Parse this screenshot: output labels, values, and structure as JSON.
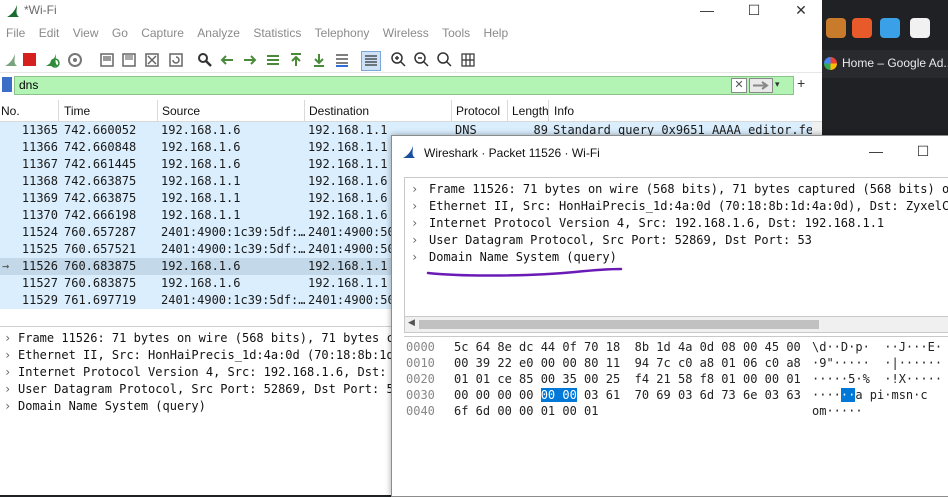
{
  "main_window": {
    "title": "*Wi-Fi",
    "controls": {
      "minimize": "—",
      "maximize": "☐",
      "close": "✕"
    },
    "menu": [
      "File",
      "Edit",
      "View",
      "Go",
      "Capture",
      "Analyze",
      "Statistics",
      "Telephony",
      "Wireless",
      "Tools",
      "Help"
    ],
    "filter": {
      "value": "dns",
      "clear": "✕",
      "dropdown": "▾",
      "add": "+"
    },
    "columns": [
      "No.",
      "Time",
      "Source",
      "Destination",
      "Protocol",
      "Length",
      "Info"
    ],
    "packets": [
      {
        "no": "11365",
        "time": "742.660052",
        "src": "192.168.1.6",
        "dst": "192.168.1.1",
        "proto": "DNS",
        "len": "89",
        "info": "Standard query 0x9651 AAAA editor.fe"
      },
      {
        "no": "11366",
        "time": "742.660848",
        "src": "192.168.1.6",
        "dst": "192.168.1.1",
        "proto": "",
        "len": "",
        "info": ""
      },
      {
        "no": "11367",
        "time": "742.661445",
        "src": "192.168.1.6",
        "dst": "192.168.1.1",
        "proto": "",
        "len": "",
        "info": ""
      },
      {
        "no": "11368",
        "time": "742.663875",
        "src": "192.168.1.1",
        "dst": "192.168.1.6",
        "proto": "",
        "len": "",
        "info": ""
      },
      {
        "no": "11369",
        "time": "742.663875",
        "src": "192.168.1.1",
        "dst": "192.168.1.6",
        "proto": "",
        "len": "",
        "info": ""
      },
      {
        "no": "11370",
        "time": "742.666198",
        "src": "192.168.1.1",
        "dst": "192.168.1.6",
        "proto": "",
        "len": "",
        "info": ""
      },
      {
        "no": "11524",
        "time": "760.657287",
        "src": "2401:4900:1c39:5df:…",
        "dst": "2401:4900:50",
        "proto": "",
        "len": "",
        "info": ""
      },
      {
        "no": "11525",
        "time": "760.657521",
        "src": "2401:4900:1c39:5df:…",
        "dst": "2401:4900:50",
        "proto": "",
        "len": "",
        "info": ""
      },
      {
        "no": "11526",
        "time": "760.683875",
        "src": "192.168.1.6",
        "dst": "192.168.1.1",
        "proto": "",
        "len": "",
        "info": "",
        "selected": true
      },
      {
        "no": "11527",
        "time": "760.683875",
        "src": "192.168.1.6",
        "dst": "192.168.1.1",
        "proto": "",
        "len": "",
        "info": ""
      },
      {
        "no": "11529",
        "time": "761.697719",
        "src": "2401:4900:1c39:5df:…",
        "dst": "2401:4900:50",
        "proto": "",
        "len": "",
        "info": ""
      }
    ],
    "details": [
      "Frame 11526: 71 bytes on wire (568 bits), 71 bytes ca",
      "Ethernet II, Src: HonHaiPrecis_1d:4a:0d (70:18:8b:1d:",
      "Internet Protocol Version 4, Src: 192.168.1.6, Dst: 1",
      "User Datagram Protocol, Src Port: 52869, Dst Port: 53",
      "Domain Name System (query)"
    ],
    "tree_arrow": "›"
  },
  "browser_strip": {
    "tab_title": "Home – Google Ad..."
  },
  "packet_window": {
    "title": "Wireshark · Packet 11526 · Wi-Fi",
    "controls": {
      "minimize": "—",
      "maximize": "☐"
    },
    "tree": [
      "Frame 11526: 71 bytes on wire (568 bits), 71 bytes captured (568 bits) on i",
      "Ethernet II, Src: HonHaiPrecis_1d:4a:0d (70:18:8b:1d:4a:0d), Dst: ZyxelComm",
      "Internet Protocol Version 4, Src: 192.168.1.6, Dst: 192.168.1.1",
      "User Datagram Protocol, Src Port: 52869, Dst Port: 53",
      "Domain Name System (query)"
    ],
    "hex_offsets": [
      "0000",
      "0010",
      "0020",
      "0030",
      "0040"
    ],
    "hex_rows": [
      "5c 64 8e dc 44 0f 70 18  8b 1d 4a 0d 08 00 45 00",
      "00 39 22 e0 00 00 80 11  94 7c c0 a8 01 06 c0 a8",
      "01 01 ce 85 00 35 00 25  f4 21 58 f8 01 00 00 01",
      "00 00 00 00 00 00 03 61  70 69 03 6d 73 6e 03 63",
      "6f 6d 00 00 01 00 01"
    ],
    "hex_highlight": "00 00",
    "ascii_rows": [
      "\\d··D·p·  ··J···E·",
      "·9\"·····  ·|······",
      "·····5·%  ·!X·····",
      "······a pi·msn·c",
      "om·····"
    ],
    "ascii_highlight": "··"
  },
  "colors": {
    "row_bg": "#daeefd",
    "row_selected": "#c3d9ea",
    "filter_ok": "#b3f3b3",
    "highlight": "#0078d7",
    "annotation": "#6a1bb5"
  }
}
